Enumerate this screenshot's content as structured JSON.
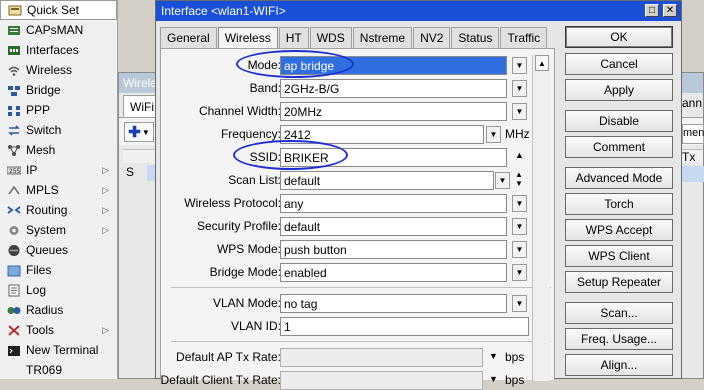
{
  "sidebar": {
    "items": [
      {
        "label": "Quick Set",
        "icon": "quick-set-icon",
        "arrow": false
      },
      {
        "label": "CAPsMAN",
        "icon": "capsman-icon",
        "arrow": false
      },
      {
        "label": "Interfaces",
        "icon": "interfaces-icon",
        "arrow": false
      },
      {
        "label": "Wireless",
        "icon": "wireless-icon",
        "arrow": false
      },
      {
        "label": "Bridge",
        "icon": "bridge-icon",
        "arrow": false
      },
      {
        "label": "PPP",
        "icon": "ppp-icon",
        "arrow": false
      },
      {
        "label": "Switch",
        "icon": "switch-icon",
        "arrow": false
      },
      {
        "label": "Mesh",
        "icon": "mesh-icon",
        "arrow": false
      },
      {
        "label": "IP",
        "icon": "ip-icon",
        "arrow": true
      },
      {
        "label": "MPLS",
        "icon": "mpls-icon",
        "arrow": true
      },
      {
        "label": "Routing",
        "icon": "routing-icon",
        "arrow": true
      },
      {
        "label": "System",
        "icon": "system-icon",
        "arrow": true
      },
      {
        "label": "Queues",
        "icon": "queues-icon",
        "arrow": false
      },
      {
        "label": "Files",
        "icon": "files-icon",
        "arrow": false
      },
      {
        "label": "Log",
        "icon": "log-icon",
        "arrow": false
      },
      {
        "label": "Radius",
        "icon": "radius-icon",
        "arrow": false
      },
      {
        "label": "Tools",
        "icon": "tools-icon",
        "arrow": true
      },
      {
        "label": "New Terminal",
        "icon": "terminal-icon",
        "arrow": false
      },
      {
        "label": "TR069",
        "icon": "",
        "arrow": false
      }
    ]
  },
  "background_window": {
    "title": "Wirele",
    "tab": "WiFi",
    "row_flag": "S",
    "right_header": "ann",
    "right_tab": "ment",
    "right_col": "Tx P"
  },
  "dialog": {
    "title": "Interface <wlan1-WIFI>",
    "tabs": [
      "General",
      "Wireless",
      "HT",
      "WDS",
      "Nstreme",
      "NV2",
      "Status",
      "Traffic"
    ],
    "active_tab": "Wireless",
    "fields": {
      "mode": {
        "label": "Mode:",
        "value": "ap bridge"
      },
      "band": {
        "label": "Band:",
        "value": "2GHz-B/G"
      },
      "channel_width": {
        "label": "Channel Width:",
        "value": "20MHz"
      },
      "frequency": {
        "label": "Frequency:",
        "value": "2412",
        "unit": "MHz"
      },
      "ssid": {
        "label": "SSID:",
        "value": "BRIKER"
      },
      "scan_list": {
        "label": "Scan List:",
        "value": "default"
      },
      "wireless_protocol": {
        "label": "Wireless Protocol:",
        "value": "any"
      },
      "security_profile": {
        "label": "Security Profile:",
        "value": "default"
      },
      "wps_mode": {
        "label": "WPS Mode:",
        "value": "push button"
      },
      "bridge_mode": {
        "label": "Bridge Mode:",
        "value": "enabled"
      },
      "vlan_mode": {
        "label": "VLAN Mode:",
        "value": "no tag"
      },
      "vlan_id": {
        "label": "VLAN ID:",
        "value": "1"
      },
      "default_ap_tx_rate": {
        "label": "Default AP Tx Rate:",
        "value": "",
        "unit": "bps"
      },
      "default_client_tx_rate": {
        "label": "Default Client Tx Rate:",
        "value": "",
        "unit": "bps"
      }
    },
    "buttons": [
      "OK",
      "Cancel",
      "Apply",
      "Disable",
      "Comment",
      "Advanced Mode",
      "Torch",
      "WPS Accept",
      "WPS Client",
      "Setup Repeater",
      "Scan...",
      "Freq. Usage...",
      "Align..."
    ]
  },
  "colors": {
    "titlebar": "#1a4fd8",
    "selection": "#2f6fe0",
    "annotation": "#1f2fd8"
  }
}
